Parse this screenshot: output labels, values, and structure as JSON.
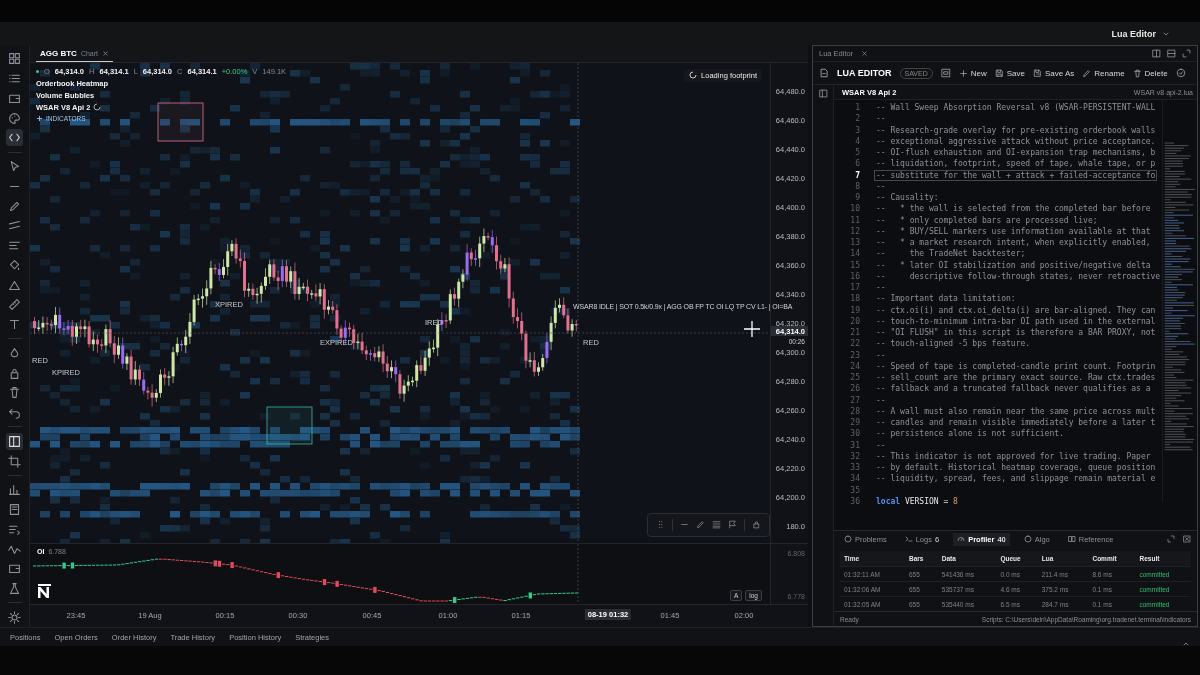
{
  "window": {
    "title": "Lua Editor"
  },
  "chart_panel": {
    "tab": {
      "symbol": "AGG BTC",
      "type": "Chart"
    },
    "ohlc": [
      {
        "label": "O",
        "value": "64,314.0"
      },
      {
        "label": "H",
        "value": "64,314.1"
      },
      {
        "label": "L",
        "value": "64,314.0"
      },
      {
        "label": "C",
        "value": "64,314.1"
      }
    ],
    "change": "+0.00%",
    "volume": {
      "label": "V",
      "value": "149.1K"
    },
    "indicators": [
      {
        "name": "Orderbook Heatmap"
      },
      {
        "name": "Volume Bubbles"
      },
      {
        "name": "WSAR V8 Api 2",
        "loading": true
      }
    ],
    "add_indicators": "INDICATORS",
    "loading_badge": "Loading footprint",
    "status_overlay": "WSAR8 IDLE | SOT 0.5k/0.9x | AGG OB FP TC OI LQ TP CV L1- | OI=BA",
    "signal_labels": [
      "RED",
      "KPIRED",
      "XPIRED",
      "EXPIRED",
      "IRED",
      "RED"
    ],
    "price_axis": [
      "64,480.0",
      "64,460.0",
      "64,440.0",
      "64,420.0",
      "64,400.0",
      "64,380.0",
      "64,360.0",
      "64,340.0",
      "64,320.0",
      "64,300.0",
      "64,280.0",
      "64,260.0",
      "64,240.0",
      "64,220.0",
      "64,200.0",
      "180.0"
    ],
    "current_price": {
      "value": "64,314.0",
      "countdown": "00:26"
    },
    "oi_panel": {
      "label": "OI",
      "value": "6.788",
      "axis": [
        "6.808",
        "6.778"
      ],
      "auto_button": "A",
      "log_button": "log"
    },
    "time_axis": [
      {
        "label": "23:45",
        "current": false
      },
      {
        "label": "19 Aug",
        "current": false
      },
      {
        "label": "00:15",
        "current": false
      },
      {
        "label": "00:30",
        "current": false
      },
      {
        "label": "00:45",
        "current": false
      },
      {
        "label": "01:00",
        "current": false
      },
      {
        "label": "01:15",
        "current": false
      },
      {
        "label": "08-19 01:32",
        "current": true
      },
      {
        "label": "01:45",
        "current": false
      },
      {
        "label": "02:00",
        "current": false
      }
    ]
  },
  "editor": {
    "tab": "Lua Editor",
    "title": "LUA EDITOR",
    "save_state": "SAVED",
    "actions": [
      "New",
      "Save",
      "Save As",
      "Rename",
      "Delete"
    ],
    "script_name": "WSAR V8 Api 2",
    "file_name": "WSAR v8 api-2.lua",
    "lines": [
      {
        "n": "1",
        "kind": "comment",
        "text": "-- Wall Sweep Absorption Reversal v8 (WSAR-PERSISTENT-WALL",
        "current": false
      },
      {
        "n": "2",
        "kind": "comment",
        "text": "--",
        "current": false
      },
      {
        "n": "3",
        "kind": "comment",
        "text": "-- Research-grade overlay for pre-existing orderbook walls",
        "current": false
      },
      {
        "n": "4",
        "kind": "comment",
        "text": "-- exceptional aggressive attack without price acceptance.",
        "current": false
      },
      {
        "n": "5",
        "kind": "comment",
        "text": "-- OI-flush exhaustion and OI-expansion trap mechanisms, b",
        "current": false
      },
      {
        "n": "6",
        "kind": "comment",
        "text": "-- liquidation, footprint, speed of tape, whale tape, or p",
        "current": false
      },
      {
        "n": "7",
        "kind": "comment",
        "text": "-- substitute for the wall + attack + failed-acceptance fo",
        "current": true
      },
      {
        "n": "8",
        "kind": "comment",
        "text": "--",
        "current": false
      },
      {
        "n": "9",
        "kind": "comment",
        "text": "-- Causality:",
        "current": false
      },
      {
        "n": "10",
        "kind": "comment",
        "text": "--   * the wall is selected from the completed bar before",
        "current": false
      },
      {
        "n": "11",
        "kind": "comment",
        "text": "--   * only completed bars are processed live;",
        "current": false
      },
      {
        "n": "12",
        "kind": "comment",
        "text": "--   * BUY/SELL markers use information available at that",
        "current": false
      },
      {
        "n": "13",
        "kind": "comment",
        "text": "--   * a market research intent, when explicitly enabled,",
        "current": false
      },
      {
        "n": "14",
        "kind": "comment",
        "text": "--     the TradeNet backtester;",
        "current": false
      },
      {
        "n": "15",
        "kind": "comment",
        "text": "--   * later OI stabilization and positive/negative delta",
        "current": false
      },
      {
        "n": "16",
        "kind": "comment",
        "text": "--     descriptive follow-through states, never retroactive",
        "current": false
      },
      {
        "n": "17",
        "kind": "comment",
        "text": "--",
        "current": false
      },
      {
        "n": "18",
        "kind": "comment",
        "text": "-- Important data limitation:",
        "current": false
      },
      {
        "n": "19",
        "kind": "comment",
        "text": "-- ctx.oi(i) and ctx.oi_delta(i) are bar-aligned. They can",
        "current": false
      },
      {
        "n": "20",
        "kind": "comment",
        "text": "-- touch-to-minimum intra-bar OI path used in the external",
        "current": false
      },
      {
        "n": "21",
        "kind": "comment",
        "text": "-- \"OI FLUSH\" in this script is therefore a BAR PROXY, not",
        "current": false
      },
      {
        "n": "22",
        "kind": "comment",
        "text": "-- touch-aligned -5 bps feature.",
        "current": false
      },
      {
        "n": "23",
        "kind": "comment",
        "text": "--",
        "current": false
      },
      {
        "n": "24",
        "kind": "comment",
        "text": "-- Speed of tape is completed-candle print count. Footprin",
        "current": false
      },
      {
        "n": "25",
        "kind": "comment",
        "text": "-- sell_count are the primary exact source. Raw ctx.trades",
        "current": false
      },
      {
        "n": "26",
        "kind": "comment",
        "text": "-- fallback and a truncated fallback never qualifies as a",
        "current": false
      },
      {
        "n": "27",
        "kind": "comment",
        "text": "--",
        "current": false
      },
      {
        "n": "28",
        "kind": "comment",
        "text": "-- A wall must also remain near the same price across mult",
        "current": false
      },
      {
        "n": "29",
        "kind": "comment",
        "text": "-- candles and remain visible immediately before a later t",
        "current": false
      },
      {
        "n": "30",
        "kind": "comment",
        "text": "-- persistence alone is not sufficient.",
        "current": false
      },
      {
        "n": "31",
        "kind": "comment",
        "text": "--",
        "current": false
      },
      {
        "n": "32",
        "kind": "comment",
        "text": "-- This indicator is not approved for live trading. Paper",
        "current": false
      },
      {
        "n": "33",
        "kind": "comment",
        "text": "-- by default. Historical heatmap coverage, queue position",
        "current": false
      },
      {
        "n": "34",
        "kind": "comment",
        "text": "-- liquidity, spread, fees, and slippage remain material e",
        "current": false
      },
      {
        "n": "35",
        "kind": "blank",
        "current": false
      },
      {
        "n": "36",
        "kind": "code",
        "current": false,
        "tokens": [
          {
            "kind": "keyword",
            "text": "local"
          },
          {
            "kind": "name",
            "text": "VERSION ="
          },
          {
            "kind": "number",
            "text": "8"
          }
        ]
      }
    ],
    "panel_tabs": [
      {
        "label": "Problems",
        "selected": false
      },
      {
        "label": "Logs",
        "count": "6",
        "selected": false
      },
      {
        "label": "Profiler",
        "count": "40",
        "selected": true
      },
      {
        "label": "Algo",
        "selected": false
      },
      {
        "label": "Reference",
        "selected": false
      }
    ],
    "profiler": {
      "columns": [
        "Time",
        "Bars",
        "Data",
        "Queue",
        "Lua",
        "Commit",
        "Result"
      ],
      "rows": [
        {
          "cells": [
            "01:32:11 AM",
            "655",
            "541436 ms",
            "0.0 ms",
            "211.4 ms",
            "8.6 ms"
          ],
          "result": "committed"
        },
        {
          "cells": [
            "01:32:06 AM",
            "655",
            "535737 ms",
            "4.6 ms",
            "375.2 ms",
            "0.1 ms"
          ],
          "result": "committed"
        },
        {
          "cells": [
            "01:32:05 AM",
            "655",
            "535440 ms",
            "6.5 ms",
            "284.7 ms",
            "0.1 ms"
          ],
          "result": "committed"
        }
      ]
    },
    "status": "Ready",
    "scripts_path": "Scripts: C:\\Users\\delri\\AppData\\Roaming\\org.tradenet.terminal\\indicators"
  },
  "bottom_tabs": [
    "Positions",
    "Open Orders",
    "Order History",
    "Trade History",
    "Position History",
    "Strategies"
  ]
}
